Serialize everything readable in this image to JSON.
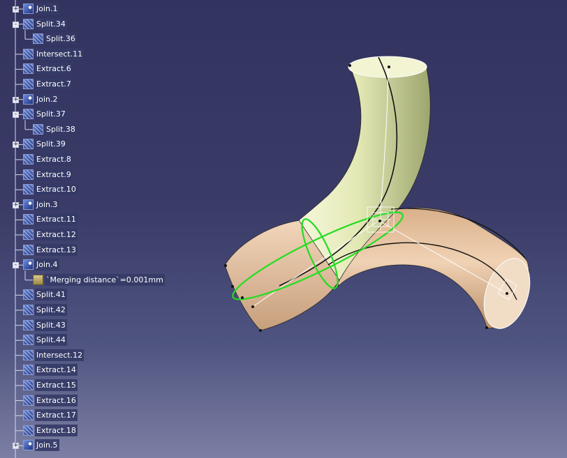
{
  "tree": {
    "items": [
      {
        "label": "Join.1",
        "icon": "join-icon",
        "level": 0,
        "expander": "+"
      },
      {
        "label": "Split.34",
        "icon": "split-icon",
        "level": 0,
        "expander": "-"
      },
      {
        "label": "Split.36",
        "icon": "split-icon",
        "level": 1,
        "expander": ""
      },
      {
        "label": "Intersect.11",
        "icon": "intersect-icon",
        "level": 0,
        "expander": ""
      },
      {
        "label": "Extract.6",
        "icon": "extract-icon",
        "level": 0,
        "expander": ""
      },
      {
        "label": "Extract.7",
        "icon": "extract-icon",
        "level": 0,
        "expander": ""
      },
      {
        "label": "Join.2",
        "icon": "join-icon",
        "level": 0,
        "expander": "+"
      },
      {
        "label": "Split.37",
        "icon": "split-icon",
        "level": 0,
        "expander": "-"
      },
      {
        "label": "Split.38",
        "icon": "split-icon",
        "level": 1,
        "expander": ""
      },
      {
        "label": "Split.39",
        "icon": "split-icon",
        "level": 0,
        "expander": "+"
      },
      {
        "label": "Extract.8",
        "icon": "extract-icon",
        "level": 0,
        "expander": ""
      },
      {
        "label": "Extract.9",
        "icon": "extract-icon",
        "level": 0,
        "expander": ""
      },
      {
        "label": "Extract.10",
        "icon": "extract-icon",
        "level": 0,
        "expander": ""
      },
      {
        "label": "Join.3",
        "icon": "join-icon",
        "level": 0,
        "expander": "+"
      },
      {
        "label": "Extract.11",
        "icon": "extract-icon",
        "level": 0,
        "expander": ""
      },
      {
        "label": "Extract.12",
        "icon": "extract-icon",
        "level": 0,
        "expander": ""
      },
      {
        "label": "Extract.13",
        "icon": "extract-icon",
        "level": 0,
        "expander": ""
      },
      {
        "label": "Join.4",
        "icon": "join-icon",
        "level": 0,
        "expander": "-"
      },
      {
        "label": "`Merging distance`=0.001mm",
        "icon": "parameter-icon",
        "level": 1,
        "expander": ""
      },
      {
        "label": "Split.41",
        "icon": "split-icon",
        "level": 0,
        "expander": ""
      },
      {
        "label": "Split.42",
        "icon": "split-icon",
        "level": 0,
        "expander": ""
      },
      {
        "label": "Split.43",
        "icon": "split-icon",
        "level": 0,
        "expander": ""
      },
      {
        "label": "Split.44",
        "icon": "split-icon",
        "level": 0,
        "expander": ""
      },
      {
        "label": "Intersect.12",
        "icon": "intersect-icon",
        "level": 0,
        "expander": ""
      },
      {
        "label": "Extract.14",
        "icon": "extract-icon",
        "level": 0,
        "expander": ""
      },
      {
        "label": "Extract.15",
        "icon": "extract-icon",
        "level": 0,
        "expander": ""
      },
      {
        "label": "Extract.16",
        "icon": "extract-icon",
        "level": 0,
        "expander": ""
      },
      {
        "label": "Extract.17",
        "icon": "extract-icon",
        "level": 0,
        "expander": ""
      },
      {
        "label": "Extract.18",
        "icon": "extract-icon",
        "level": 0,
        "expander": ""
      },
      {
        "label": "Join.5",
        "icon": "join-icon",
        "level": 0,
        "expander": "+"
      }
    ]
  },
  "viewport": {
    "model": "y-pipe-surface",
    "colors": {
      "background_top": "#33335f",
      "background_bottom": "#7c7fa3",
      "upper_pipe": "#e3e8b4",
      "side_pipe": "#e0b994",
      "highlight": "#22dd22",
      "tree_text": "#ffffff"
    }
  }
}
